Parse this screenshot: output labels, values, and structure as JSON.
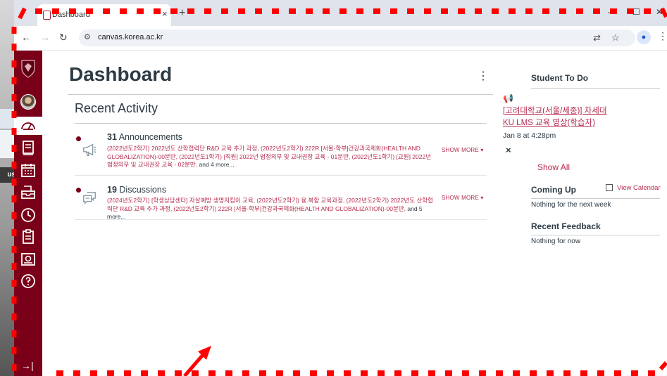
{
  "desktop": {
    "tip_text": "us"
  },
  "browser": {
    "tab_title": "Dashboard",
    "tab_close": "×",
    "new_tab": "+",
    "url": "canvas.korea.ac.kr"
  },
  "page": {
    "title": "Dashboard",
    "recent_activity_heading": "Recent Activity",
    "activities": [
      {
        "count": "31",
        "type": "Announcements",
        "items": "(2022년도2학기) 2022년도 산학협력단 R&D 교육 추가 과정, (2022년도2학기) 222R [서울-학부]건강과국제화(HEALTH AND GLOBALIZATION)-00분반, (2022년도1학기) [직원] 2022년 법정의무 및 교내권장 교육 - 01분반, (2022년도1학기) [교원] 2022년 법정의무 및 교내권장 교육 - 02분반,",
        "more": " and 4 more...",
        "show_more": "SHOW MORE"
      },
      {
        "count": "19",
        "type": "Discussions",
        "items": "(2024년도2학기) [학생상담센터] 자살예방 생명지킴이 교육, (2022년도2학기) 융.복합 교육과정, (2022년도2학기) 2022년도 산학협력단 R&D 교육 추가 과정, (2022년도2학기) 222R [서울-학부]건강과국제화(HEALTH AND GLOBALIZATION)-00분반,",
        "more": " and 5 more...",
        "show_more": "SHOW MORE"
      }
    ]
  },
  "right": {
    "todo_heading": "Student To Do",
    "todo_link": "[고려대학교(서울/세종)] 차세대 KU LMS 교육 영상(학습자)",
    "todo_date": "Jan 8 at 4:28pm",
    "dismiss": "×",
    "show_all": "Show All",
    "coming_up_heading": "Coming Up",
    "view_calendar": "View Calendar",
    "coming_up_text": "Nothing for the next week",
    "feedback_heading": "Recent Feedback",
    "feedback_text": "Nothing for now"
  },
  "colors": {
    "brand": "#7a0019",
    "link": "#b5294c",
    "annotation": "#ff0000"
  }
}
